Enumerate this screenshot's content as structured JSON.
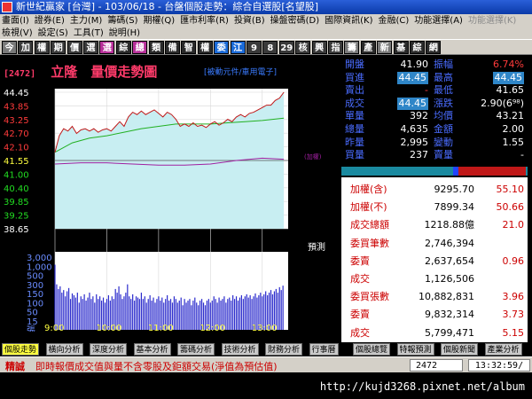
{
  "window": {
    "title": "新世紀贏家 [台灣] - 103/06/18 - 台盤個股走勢：綜合自選股[名望股]"
  },
  "menu": {
    "row1": [
      "畫面(I)",
      "證券(E)",
      "主力(M)",
      "籌碼(S)",
      "期權(Q)",
      "匯市利率(R)",
      "投資(B)",
      "操盤密碼(D)",
      "國際資訊(K)",
      "金融(C)",
      "功能選擇(A)",
      "功能選擇(K)"
    ],
    "row1_disabled": [
      false,
      false,
      false,
      false,
      false,
      false,
      false,
      false,
      false,
      false,
      false,
      true
    ],
    "row2": [
      "檢視(V)",
      "設定(S)",
      "工具(T)",
      "說明(H)"
    ]
  },
  "toolbar": {
    "buttons": [
      {
        "label": "今",
        "color": "#7a7a7a"
      },
      {
        "label": "加",
        "color": "#3a3a3a"
      },
      {
        "label": "權",
        "color": "#3a3a3a"
      },
      {
        "label": "期",
        "color": "#3a3a3a"
      },
      {
        "label": "價",
        "color": "#3a3a3a"
      },
      {
        "label": "選",
        "color": "#3a3a3a"
      },
      {
        "label": "選",
        "color": "#b8309a"
      },
      {
        "label": "綜",
        "color": "#2a2a2a"
      },
      {
        "label": "總",
        "color": "#b8309a"
      },
      {
        "label": "類",
        "color": "#2a2a2a"
      },
      {
        "label": "備",
        "color": "#2a2a2a"
      },
      {
        "label": "智",
        "color": "#2a2a2a"
      },
      {
        "label": "權",
        "color": "#2a2a2a"
      },
      {
        "label": "委",
        "color": "#1a6ad8"
      },
      {
        "label": "江",
        "color": "#1a6ad8"
      },
      {
        "label": "9",
        "color": "#3a3a3a"
      },
      {
        "label": "8",
        "color": "#3a3a3a"
      },
      {
        "label": "29",
        "color": "#3a3a3a"
      },
      {
        "label": "核",
        "color": "#3a3a3a"
      },
      {
        "label": "興",
        "color": "#3a3a3a"
      },
      {
        "label": "指",
        "color": "#3a3a3a"
      },
      {
        "label": "籌",
        "color": "#7a7a7a"
      },
      {
        "label": "產",
        "color": "#2a2a2a"
      },
      {
        "label": "新",
        "color": "#7a7a7a"
      },
      {
        "label": "基",
        "color": "#2a2a2a"
      },
      {
        "label": "綜",
        "color": "#2a2a2a"
      },
      {
        "label": "網",
        "color": "#2a2a2a"
      }
    ]
  },
  "stock": {
    "code": "[2472]",
    "name": "立隆",
    "chart_title": "量價走勢圖",
    "source": "[被動元件/車用電子]"
  },
  "quote": {
    "rows": [
      {
        "l1": "開盤",
        "v1": "41.90",
        "l2": "振幅",
        "v2": "6.74%",
        "c1": "#fff",
        "c2": "#ff3b3b"
      },
      {
        "l1": "買進",
        "v1": "44.45",
        "l2": "最高",
        "v2": "44.45",
        "c1": "hl",
        "c2": "hl"
      },
      {
        "l1": "賣出",
        "v1": "-",
        "l2": "最低",
        "v2": "41.65",
        "c1": "#ff3b3b",
        "c2": "#fff"
      },
      {
        "l1": "成交",
        "v1": "44.45",
        "l2": "漲跌",
        "v2": "2.90(6⁹⁸)",
        "c1": "hl",
        "c2": "#fff"
      },
      {
        "l1": "單量",
        "v1": "392",
        "l2": "均價",
        "v2": "43.21",
        "c1": "#fff",
        "c2": "#fff"
      },
      {
        "l1": "總量",
        "v1": "4,635",
        "l2": "金額",
        "v2": "2.00",
        "c1": "#fff",
        "c2": "#fff"
      },
      {
        "l1": "昨量",
        "v1": "2,995",
        "l2": "變動",
        "v2": "1.55",
        "c1": "#fff",
        "c2": "#fff"
      },
      {
        "l1": "買量",
        "v1": "237",
        "l2": "賣量",
        "v2": "-",
        "c1": "#fff",
        "c2": "#fff"
      }
    ]
  },
  "stats": {
    "rows": [
      {
        "l": "加權(含)",
        "v1": "9295.70",
        "v2": "55.10",
        "r1": false
      },
      {
        "l": "加權(不)",
        "v1": "7899.34",
        "v2": "50.66",
        "r1": false
      },
      {
        "l": "成交總額",
        "v1": "1218.88億",
        "v2": "21.0",
        "r1": false
      },
      {
        "l": "委買筆數",
        "v1": "2,746,394",
        "v2": "",
        "r1": false
      },
      {
        "l": "委賣",
        "v1": "2,637,654",
        "v2": "0.96",
        "r1": false
      },
      {
        "l": "成交",
        "v1": "1,126,506",
        "v2": "",
        "r1": false
      },
      {
        "l": "委買張數",
        "v1": "10,882,831",
        "v2": "3.96",
        "r1": false
      },
      {
        "l": "委賣",
        "v1": "9,832,314",
        "v2": "3.73",
        "r1": false
      },
      {
        "l": "成交",
        "v1": "5,799,471",
        "v2": "5.15",
        "r1": false
      }
    ]
  },
  "ticker": {
    "items": [
      "個股走勢",
      "橫向分析",
      "深度分析",
      "基本分析",
      "籌碼分析",
      "技術分析",
      "財務分析",
      "行事曆",
      "個股總覽",
      "特報預測",
      "個股新聞",
      "產業分析"
    ],
    "selected": 0
  },
  "status": {
    "label": "精誠",
    "message": "即時報價成交值與量不含零股及鉅額交易(淨值為預估值)",
    "code": "2472",
    "time": "13:32:59/"
  },
  "footer": {
    "url": "http://kujd3268.pixnet.net/album"
  },
  "chart_data": {
    "type": "line",
    "title": "量價走勢圖",
    "price_ticks": [
      "44.45",
      "43.85",
      "43.25",
      "42.70",
      "42.10",
      "41.55",
      "41.00",
      "40.40",
      "39.85",
      "39.25",
      "38.65"
    ],
    "price_ylim": [
      38.65,
      44.45
    ],
    "ref_price": 41.55,
    "ref_label": "(加權)",
    "volume_ticks": [
      "3,000",
      "1,000",
      "500",
      "300",
      "150",
      "100",
      "50",
      "15",
      "張"
    ],
    "volume_label": "張",
    "x_ticks": [
      "9:00",
      "10:00",
      "11:00",
      "12:00",
      "13:00"
    ],
    "x_range_min": [
      0,
      270
    ],
    "preset_label": "預測",
    "price_series": [
      [
        0,
        41.9
      ],
      [
        5,
        42.6
      ],
      [
        10,
        42.9
      ],
      [
        15,
        42.8
      ],
      [
        20,
        43.0
      ],
      [
        25,
        42.7
      ],
      [
        30,
        42.85
      ],
      [
        35,
        42.9
      ],
      [
        40,
        42.8
      ],
      [
        45,
        42.9
      ],
      [
        50,
        42.75
      ],
      [
        55,
        42.85
      ],
      [
        60,
        42.9
      ],
      [
        65,
        42.8
      ],
      [
        70,
        43.0
      ],
      [
        75,
        43.2
      ],
      [
        80,
        43.0
      ],
      [
        85,
        43.4
      ],
      [
        90,
        43.6
      ],
      [
        95,
        43.5
      ],
      [
        100,
        43.65
      ],
      [
        105,
        43.5
      ],
      [
        110,
        43.6
      ],
      [
        115,
        43.7
      ],
      [
        120,
        43.55
      ],
      [
        125,
        43.4
      ],
      [
        130,
        43.6
      ],
      [
        135,
        43.5
      ],
      [
        140,
        43.3
      ],
      [
        145,
        43.0
      ],
      [
        150,
        43.1
      ],
      [
        155,
        43.0
      ],
      [
        160,
        43.15
      ],
      [
        165,
        43.0
      ],
      [
        170,
        43.05
      ],
      [
        175,
        42.95
      ],
      [
        180,
        43.1
      ],
      [
        185,
        43.2
      ],
      [
        190,
        43.05
      ],
      [
        195,
        43.15
      ],
      [
        200,
        43.3
      ],
      [
        205,
        43.2
      ],
      [
        210,
        43.4
      ],
      [
        215,
        43.5
      ],
      [
        220,
        43.4
      ],
      [
        225,
        43.55
      ],
      [
        230,
        43.6
      ],
      [
        235,
        43.7
      ],
      [
        240,
        43.8
      ],
      [
        245,
        43.9
      ],
      [
        250,
        43.9
      ],
      [
        255,
        44.1
      ],
      [
        260,
        44.2
      ],
      [
        265,
        44.45
      ]
    ],
    "avg_series": [
      [
        0,
        41.9
      ],
      [
        20,
        42.3
      ],
      [
        40,
        42.5
      ],
      [
        60,
        42.6
      ],
      [
        80,
        42.75
      ],
      [
        100,
        42.9
      ],
      [
        120,
        43.0
      ],
      [
        140,
        43.1
      ],
      [
        160,
        43.1
      ],
      [
        180,
        43.1
      ],
      [
        200,
        43.15
      ],
      [
        220,
        43.2
      ],
      [
        240,
        43.25
      ],
      [
        265,
        43.35
      ]
    ],
    "index_series": [
      [
        0,
        41.4
      ],
      [
        30,
        41.45
      ],
      [
        60,
        41.45
      ],
      [
        90,
        41.4
      ],
      [
        120,
        41.35
      ],
      [
        150,
        41.35
      ],
      [
        180,
        41.4
      ],
      [
        210,
        41.55
      ],
      [
        240,
        41.65
      ],
      [
        265,
        41.6
      ]
    ],
    "volume_series": [
      [
        0,
        1300
      ],
      [
        2,
        150
      ],
      [
        4,
        90
      ],
      [
        6,
        120
      ],
      [
        8,
        60
      ],
      [
        10,
        80
      ],
      [
        12,
        40
      ],
      [
        14,
        70
      ],
      [
        16,
        100
      ],
      [
        18,
        30
      ],
      [
        20,
        55
      ],
      [
        22,
        45
      ],
      [
        24,
        35
      ],
      [
        26,
        60
      ],
      [
        28,
        20
      ],
      [
        30,
        40
      ],
      [
        32,
        30
      ],
      [
        34,
        50
      ],
      [
        36,
        25
      ],
      [
        38,
        35
      ],
      [
        40,
        60
      ],
      [
        42,
        30
      ],
      [
        44,
        40
      ],
      [
        46,
        20
      ],
      [
        48,
        50
      ],
      [
        50,
        30
      ],
      [
        52,
        40
      ],
      [
        54,
        25
      ],
      [
        56,
        35
      ],
      [
        58,
        20
      ],
      [
        60,
        30
      ],
      [
        62,
        45
      ],
      [
        64,
        25
      ],
      [
        66,
        40
      ],
      [
        68,
        30
      ],
      [
        70,
        90
      ],
      [
        72,
        60
      ],
      [
        74,
        120
      ],
      [
        76,
        50
      ],
      [
        78,
        30
      ],
      [
        80,
        40
      ],
      [
        82,
        60
      ],
      [
        84,
        150
      ],
      [
        86,
        40
      ],
      [
        88,
        30
      ],
      [
        90,
        50
      ],
      [
        92,
        25
      ],
      [
        94,
        40
      ],
      [
        96,
        35
      ],
      [
        98,
        30
      ],
      [
        100,
        60
      ],
      [
        102,
        30
      ],
      [
        104,
        40
      ],
      [
        106,
        20
      ],
      [
        108,
        30
      ],
      [
        110,
        45
      ],
      [
        112,
        25
      ],
      [
        114,
        35
      ],
      [
        116,
        20
      ],
      [
        118,
        30
      ],
      [
        120,
        40
      ],
      [
        122,
        25
      ],
      [
        124,
        35
      ],
      [
        126,
        20
      ],
      [
        128,
        30
      ],
      [
        130,
        45
      ],
      [
        132,
        25
      ],
      [
        134,
        30
      ],
      [
        136,
        20
      ],
      [
        138,
        40
      ],
      [
        140,
        30
      ],
      [
        142,
        20
      ],
      [
        144,
        25
      ],
      [
        146,
        35
      ],
      [
        148,
        15
      ],
      [
        150,
        30
      ],
      [
        152,
        20
      ],
      [
        154,
        25
      ],
      [
        156,
        30
      ],
      [
        158,
        15
      ],
      [
        160,
        25
      ],
      [
        162,
        35
      ],
      [
        164,
        20
      ],
      [
        166,
        15
      ],
      [
        168,
        25
      ],
      [
        170,
        30
      ],
      [
        172,
        20
      ],
      [
        174,
        15
      ],
      [
        176,
        25
      ],
      [
        178,
        30
      ],
      [
        180,
        20
      ],
      [
        182,
        25
      ],
      [
        184,
        40
      ],
      [
        186,
        30
      ],
      [
        188,
        20
      ],
      [
        190,
        35
      ],
      [
        192,
        25
      ],
      [
        194,
        30
      ],
      [
        196,
        40
      ],
      [
        198,
        20
      ],
      [
        200,
        30
      ],
      [
        202,
        35
      ],
      [
        204,
        25
      ],
      [
        206,
        45
      ],
      [
        208,
        30
      ],
      [
        210,
        40
      ],
      [
        212,
        25
      ],
      [
        214,
        35
      ],
      [
        216,
        45
      ],
      [
        218,
        30
      ],
      [
        220,
        40
      ],
      [
        222,
        50
      ],
      [
        224,
        35
      ],
      [
        226,
        45
      ],
      [
        228,
        30
      ],
      [
        230,
        40
      ],
      [
        232,
        55
      ],
      [
        234,
        35
      ],
      [
        236,
        45
      ],
      [
        238,
        60
      ],
      [
        240,
        40
      ],
      [
        242,
        50
      ],
      [
        244,
        70
      ],
      [
        246,
        45
      ],
      [
        248,
        60
      ],
      [
        250,
        80
      ],
      [
        252,
        50
      ],
      [
        254,
        70
      ],
      [
        256,
        90
      ],
      [
        258,
        60
      ],
      [
        260,
        110
      ],
      [
        262,
        80
      ],
      [
        264,
        130
      ]
    ]
  }
}
